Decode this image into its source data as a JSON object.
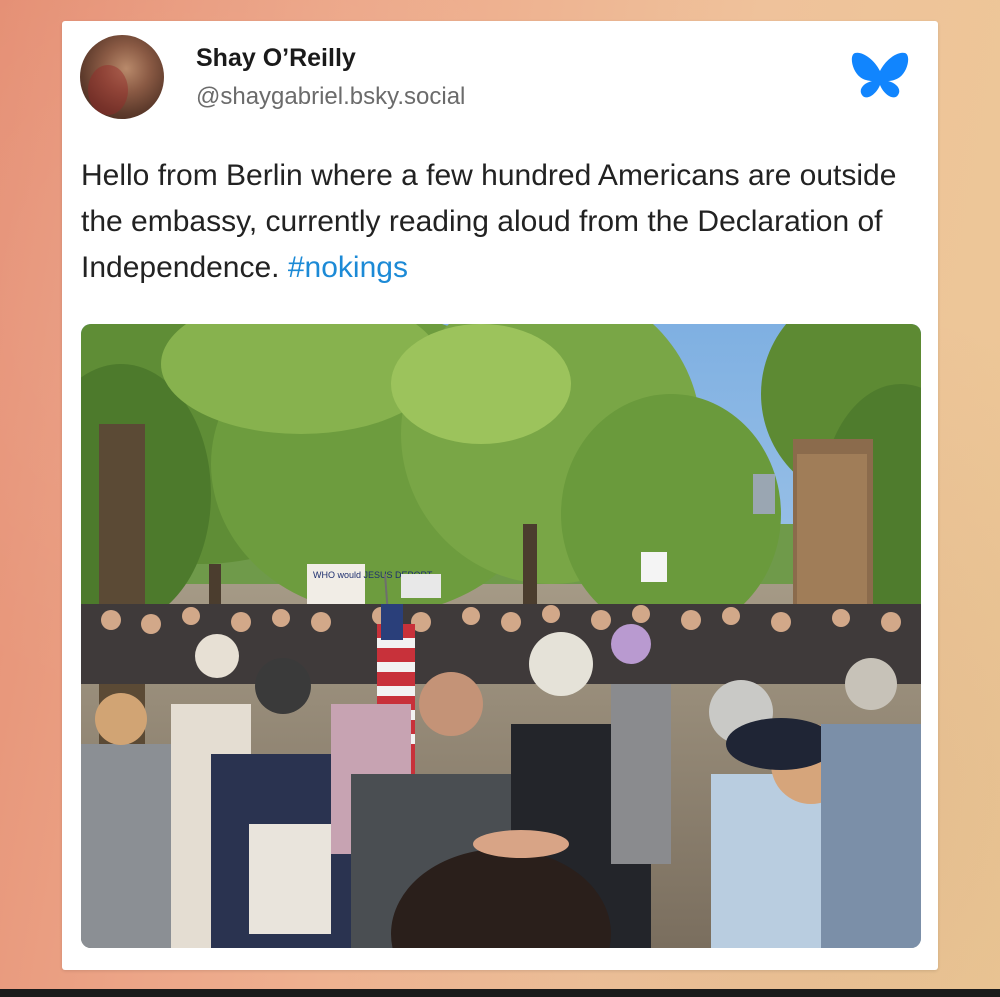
{
  "post": {
    "author_name": "Shay O’Reilly",
    "author_handle": "@shaygabriel.bsky.social",
    "text": "Hello from Berlin where a few hundred Americans are outside the embassy, currently reading aloud from the Declaration of Independence.",
    "hashtag": "#nokings"
  },
  "photo": {
    "sign_text": "WHO would JESUS DEPORT"
  },
  "icons": {
    "brand": "bluesky-butterfly-icon",
    "avatar": "profile-photo"
  },
  "colors": {
    "hashtag": "#1c8ad6",
    "brand": "#1185fe"
  }
}
